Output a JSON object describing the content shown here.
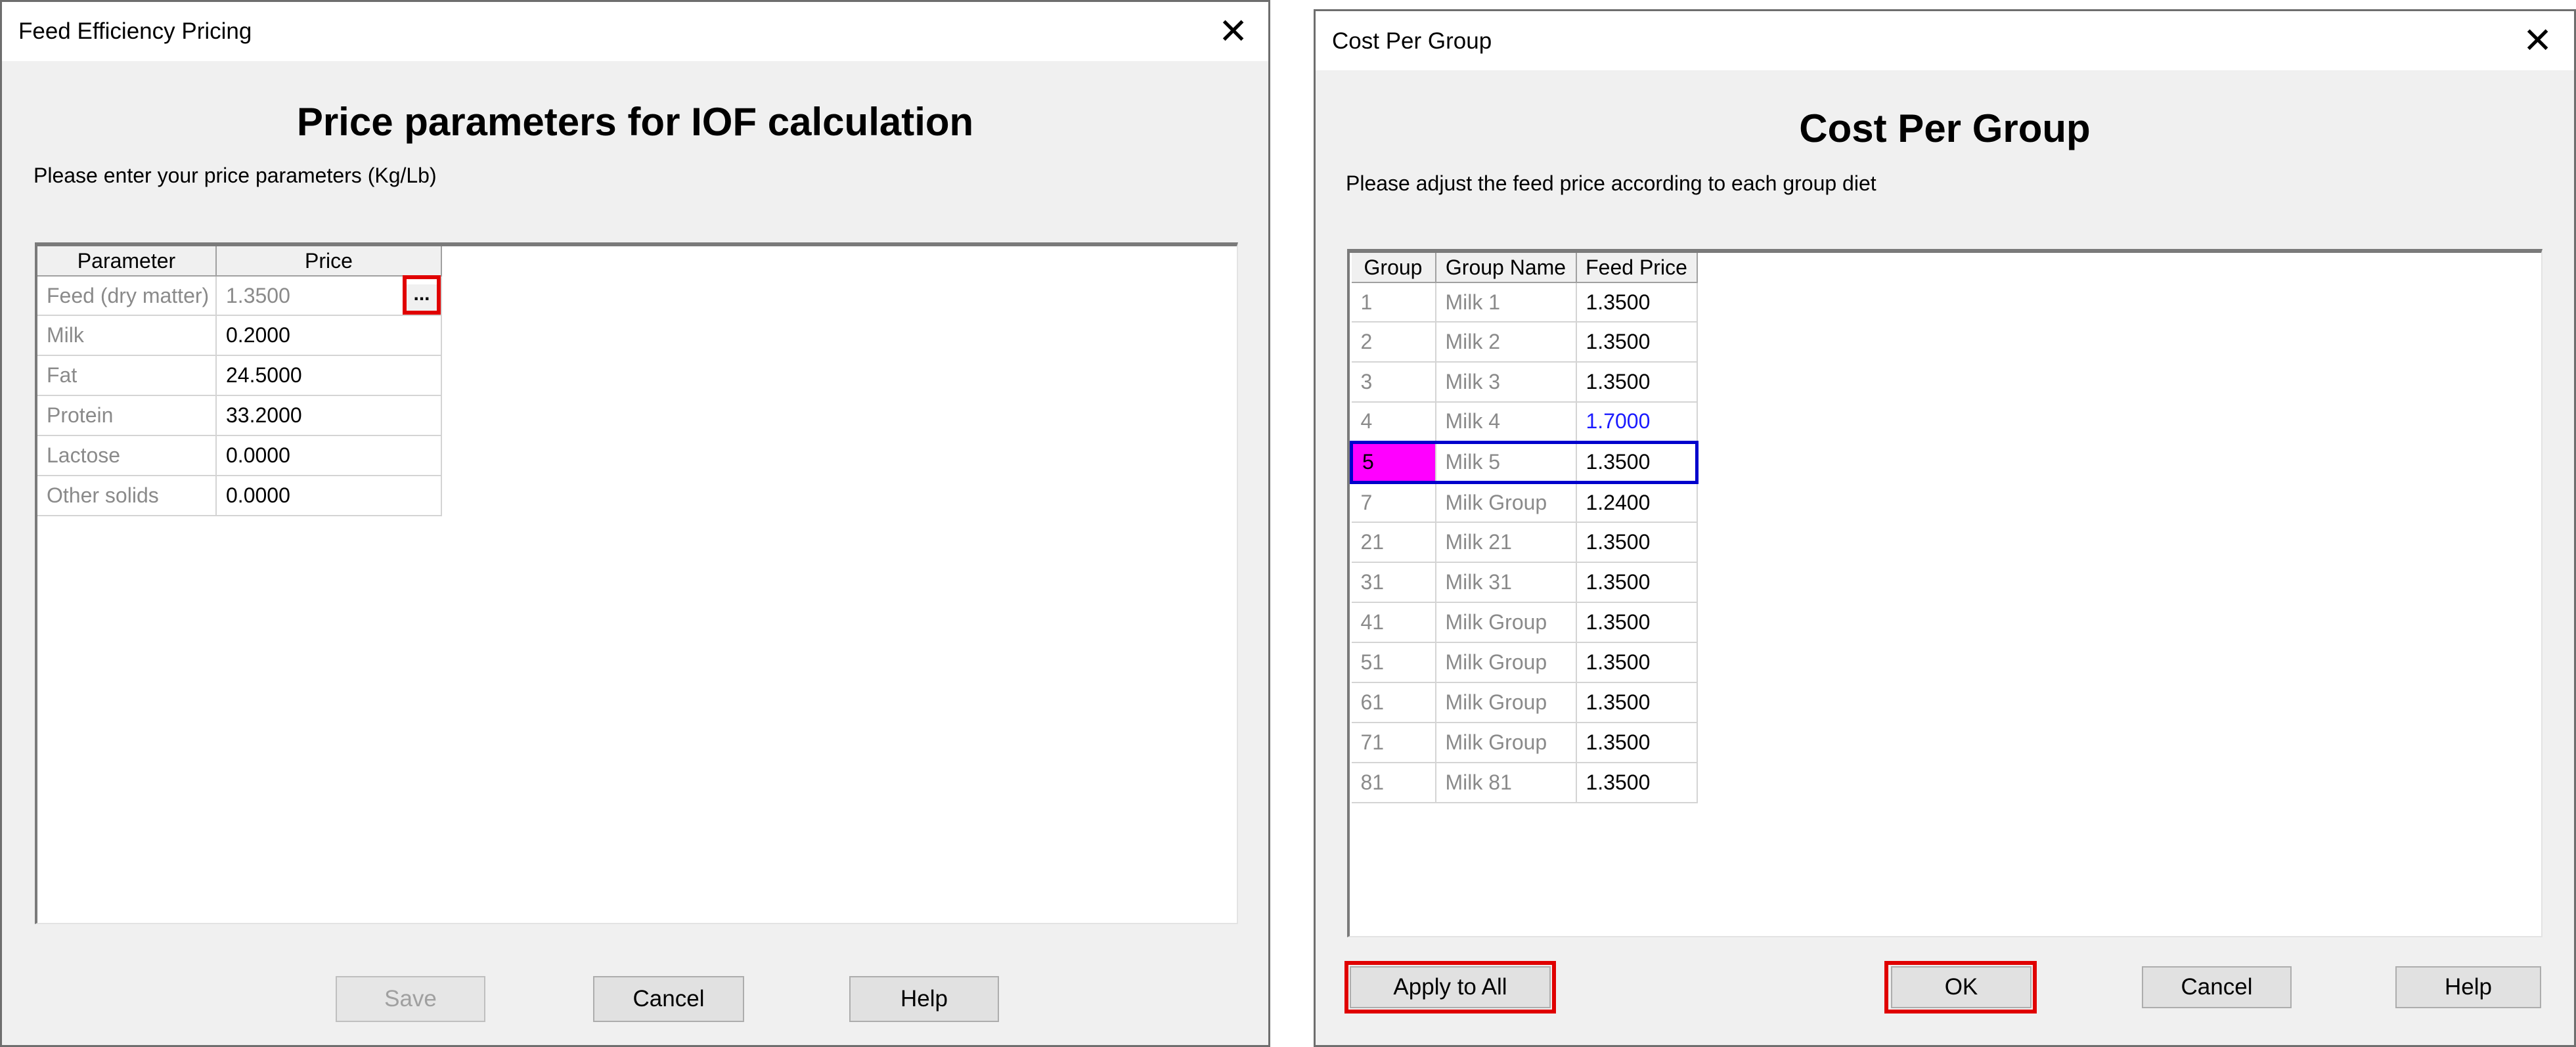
{
  "left_window": {
    "title": "Feed Efficiency Pricing",
    "heading": "Price parameters for IOF calculation",
    "instruction": "Please enter your price parameters (Kg/Lb)",
    "columns": [
      "Parameter",
      "Price"
    ],
    "rows": [
      {
        "parameter": "Feed (dry matter)",
        "price": "1.3500"
      },
      {
        "parameter": "Milk",
        "price": "0.2000"
      },
      {
        "parameter": "Fat",
        "price": "24.5000"
      },
      {
        "parameter": "Protein",
        "price": "33.2000"
      },
      {
        "parameter": "Lactose",
        "price": "0.0000"
      },
      {
        "parameter": "Other solids",
        "price": "0.0000"
      }
    ],
    "ellipsis_label": "...",
    "buttons": {
      "save": "Save",
      "cancel": "Cancel",
      "help": "Help"
    }
  },
  "right_window": {
    "title": "Cost Per Group",
    "heading": "Cost Per Group",
    "instruction": "Please adjust the feed price according to each group diet",
    "columns": [
      "Group",
      "Group Name",
      "Feed Price"
    ],
    "rows": [
      {
        "group": "1",
        "name": "Milk 1",
        "price": "1.3500"
      },
      {
        "group": "2",
        "name": "Milk 2",
        "price": "1.3500"
      },
      {
        "group": "3",
        "name": "Milk 3",
        "price": "1.3500"
      },
      {
        "group": "4",
        "name": "Milk 4",
        "price": "1.7000"
      },
      {
        "group": "5",
        "name": "Milk 5",
        "price": "1.3500"
      },
      {
        "group": "7",
        "name": "Milk Group",
        "price": "1.2400"
      },
      {
        "group": "21",
        "name": "Milk 21",
        "price": "1.3500"
      },
      {
        "group": "31",
        "name": "Milk 31",
        "price": "1.3500"
      },
      {
        "group": "41",
        "name": "Milk Group",
        "price": "1.3500"
      },
      {
        "group": "51",
        "name": "Milk Group",
        "price": "1.3500"
      },
      {
        "group": "61",
        "name": "Milk Group",
        "price": "1.3500"
      },
      {
        "group": "71",
        "name": "Milk Group",
        "price": "1.3500"
      },
      {
        "group": "81",
        "name": "Milk 81",
        "price": "1.3500"
      }
    ],
    "buttons": {
      "apply_all": "Apply to All",
      "ok": "OK",
      "cancel": "Cancel",
      "help": "Help"
    }
  },
  "colors": {
    "selected_cell": "#ff00ff",
    "selection_outline": "#0000cc",
    "edited_value": "#1a1aff",
    "highlight_box": "#e00000"
  },
  "icons": {
    "close": "close-icon"
  }
}
